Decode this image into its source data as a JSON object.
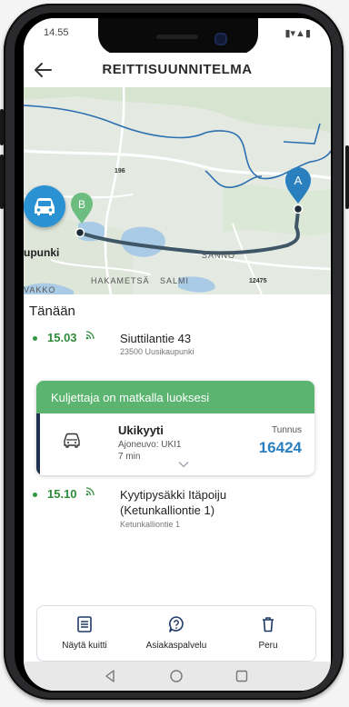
{
  "status_bar": {
    "time": "14.55",
    "right": "▮▾▲▮"
  },
  "app_bar": {
    "title": "REITTISUUNNITELMA",
    "back_icon": "arrow-left-icon"
  },
  "map": {
    "labels": {
      "town": "upunki",
      "road_196": "196",
      "road_12475": "12475",
      "sanno": "SANNO",
      "hakametsa": "HAKAMETSÄ",
      "salmi": "SALMI",
      "vakko": "VAKKO"
    },
    "markers": {
      "origin": "B",
      "destination": "A"
    },
    "colors": {
      "origin": "#6dbd80",
      "destination": "#2a7fbf",
      "route": "#3f5666",
      "boundary": "#2b6fb0"
    }
  },
  "panel": {
    "day": "Tänään",
    "stops": [
      {
        "time": "15.03",
        "place": "Siuttilantie 43",
        "sub": "23500 Uusikaupunki"
      },
      {
        "time": "15.10",
        "place_line1": "Kyytipysäkki Itäpoiju",
        "place_line2": "(Ketunkalliontie 1)",
        "sub": "Ketunkalliontie 1"
      }
    ],
    "driver_card": {
      "heading": "Kuljettaja on matkalla luoksesi",
      "service": "Ukikyyti",
      "vehicle": "Ajoneuvo: UKI1",
      "eta": "7 min",
      "code_label": "Tunnus",
      "code_value": "16424",
      "accent": "#5bb46f"
    },
    "actions": [
      {
        "label": "Näytä kuitti",
        "icon": "receipt-icon"
      },
      {
        "label": "Asiakaspalvelu",
        "icon": "support-icon"
      },
      {
        "label": "Peru",
        "icon": "trash-icon"
      }
    ]
  },
  "nav_bar": {
    "icons": [
      "nav-back-icon",
      "nav-home-icon",
      "nav-recents-icon"
    ]
  }
}
